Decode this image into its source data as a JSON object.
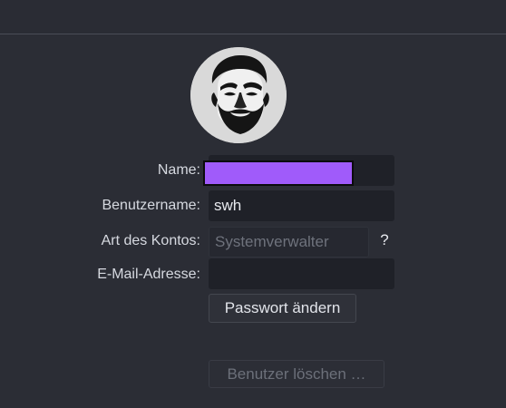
{
  "form": {
    "name_label": "Name:",
    "name_value": "",
    "username_label": "Benutzername:",
    "username_value": "swh",
    "account_type_label": "Art des Kontos:",
    "account_type_placeholder": "Systemverwalter",
    "account_type_help": "?",
    "email_label": "E-Mail-Adresse:",
    "email_value": ""
  },
  "actions": {
    "change_password": "Passwort ändern",
    "delete_user": "Benutzer löschen …"
  },
  "colors": {
    "redaction": "#a05bfa"
  },
  "icons": {
    "avatar": "user-avatar"
  }
}
